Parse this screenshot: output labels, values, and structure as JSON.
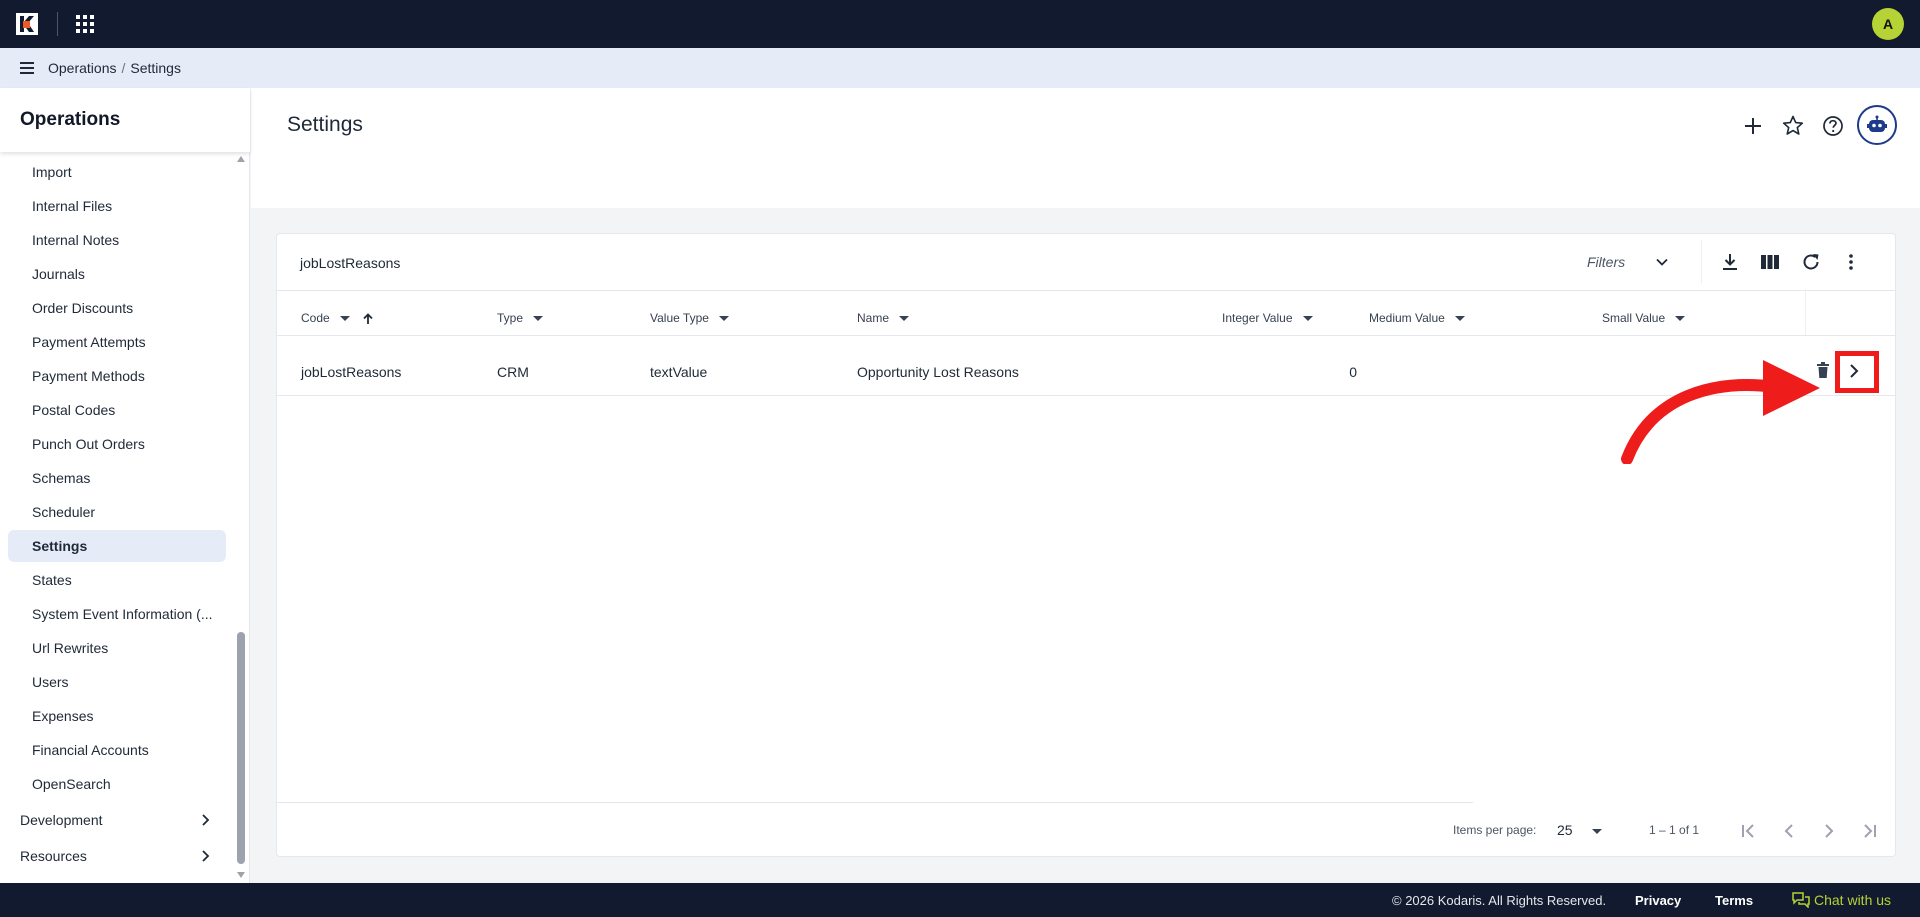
{
  "topbar": {
    "avatar_initial": "A"
  },
  "breadcrumb": {
    "items": [
      "Operations",
      "Settings"
    ]
  },
  "sidebar": {
    "title": "Operations",
    "items": [
      {
        "label": "Import",
        "active": false
      },
      {
        "label": "Internal Files",
        "active": false
      },
      {
        "label": "Internal Notes",
        "active": false
      },
      {
        "label": "Journals",
        "active": false
      },
      {
        "label": "Order Discounts",
        "active": false
      },
      {
        "label": "Payment Attempts",
        "active": false
      },
      {
        "label": "Payment Methods",
        "active": false
      },
      {
        "label": "Postal Codes",
        "active": false
      },
      {
        "label": "Punch Out Orders",
        "active": false
      },
      {
        "label": "Schemas",
        "active": false
      },
      {
        "label": "Scheduler",
        "active": false
      },
      {
        "label": "Settings",
        "active": true
      },
      {
        "label": "States",
        "active": false
      },
      {
        "label": "System Event Information (...",
        "active": false
      },
      {
        "label": "Url Rewrites",
        "active": false
      },
      {
        "label": "Users",
        "active": false
      },
      {
        "label": "Expenses",
        "active": false
      },
      {
        "label": "Financial Accounts",
        "active": false
      },
      {
        "label": "OpenSearch",
        "active": false
      }
    ],
    "groups": [
      "Development",
      "Resources"
    ]
  },
  "page": {
    "title": "Settings"
  },
  "table": {
    "title": "jobLostReasons",
    "filters_label": "Filters",
    "columns": [
      "Code",
      "Type",
      "Value Type",
      "Name",
      "Integer Value",
      "Medium Value",
      "Small Value"
    ],
    "sort": {
      "column": "Code",
      "direction": "asc"
    },
    "rows": [
      {
        "code": "jobLostReasons",
        "type": "CRM",
        "value_type": "textValue",
        "name": "Opportunity Lost Reasons",
        "integer_value": "0",
        "medium_value": "",
        "small_value": ""
      }
    ]
  },
  "pagination": {
    "items_per_page_label": "Items per page:",
    "page_size": "25",
    "range": "1 – 1 of 1"
  },
  "footer": {
    "copyright": "© 2026 Kodaris. All Rights Reserved.",
    "privacy": "Privacy",
    "terms": "Terms",
    "chat": "Chat with us"
  },
  "colors": {
    "topbar": "#111a2e",
    "accent": "#b5d334",
    "annotation": "#ef1c1c",
    "active_nav": "#e6ecf7"
  }
}
